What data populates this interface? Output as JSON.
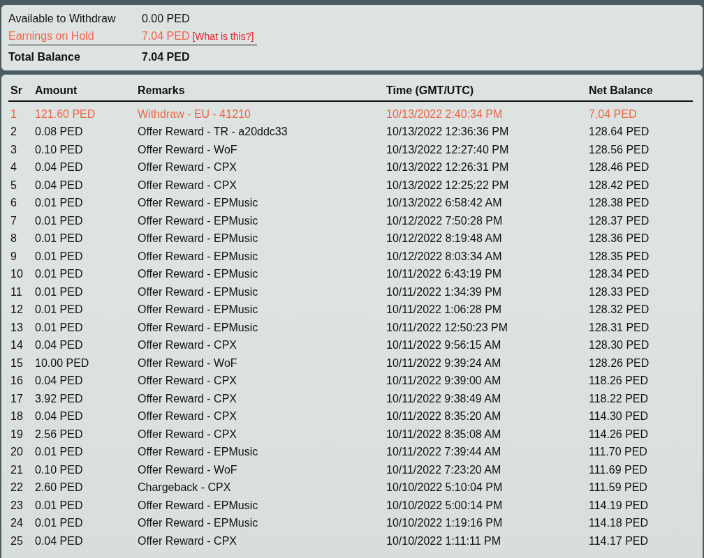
{
  "summary": [
    {
      "kind": "plain",
      "label": "Available to Withdraw",
      "value": "0.00 PED"
    },
    {
      "kind": "hold",
      "label": "Earnings on Hold",
      "value": "7.04 PED",
      "link": "[What is this?]"
    },
    {
      "kind": "total",
      "label": "Total Balance",
      "value": "7.04 PED"
    }
  ],
  "table": {
    "columns": [
      "Sr",
      "Amount",
      "Remarks",
      "Time (GMT/UTC)",
      "Net Balance"
    ],
    "rows": [
      {
        "highlighted": true,
        "cells": [
          "1",
          "121.60 PED",
          "Withdraw - EU - 41210",
          "10/13/2022 2:40:34 PM",
          "7.04 PED"
        ]
      },
      {
        "highlighted": false,
        "cells": [
          "2",
          "0.08 PED",
          "Offer Reward - TR - a20ddc33",
          "10/13/2022 12:36:36 PM",
          "128.64 PED"
        ]
      },
      {
        "highlighted": false,
        "cells": [
          "3",
          "0.10 PED",
          "Offer Reward - WoF",
          "10/13/2022 12:27:40 PM",
          "128.56 PED"
        ]
      },
      {
        "highlighted": false,
        "cells": [
          "4",
          "0.04 PED",
          "Offer Reward - CPX",
          "10/13/2022 12:26:31 PM",
          "128.46 PED"
        ]
      },
      {
        "highlighted": false,
        "cells": [
          "5",
          "0.04 PED",
          "Offer Reward - CPX",
          "10/13/2022 12:25:22 PM",
          "128.42 PED"
        ]
      },
      {
        "highlighted": false,
        "cells": [
          "6",
          "0.01 PED",
          "Offer Reward - EPMusic",
          "10/13/2022 6:58:42 AM",
          "128.38 PED"
        ]
      },
      {
        "highlighted": false,
        "cells": [
          "7",
          "0.01 PED",
          "Offer Reward - EPMusic",
          "10/12/2022 7:50:28 PM",
          "128.37 PED"
        ]
      },
      {
        "highlighted": false,
        "cells": [
          "8",
          "0.01 PED",
          "Offer Reward - EPMusic",
          "10/12/2022 8:19:48 AM",
          "128.36 PED"
        ]
      },
      {
        "highlighted": false,
        "cells": [
          "9",
          "0.01 PED",
          "Offer Reward - EPMusic",
          "10/12/2022 8:03:34 AM",
          "128.35 PED"
        ]
      },
      {
        "highlighted": false,
        "cells": [
          "10",
          "0.01 PED",
          "Offer Reward - EPMusic",
          "10/11/2022 6:43:19 PM",
          "128.34 PED"
        ]
      },
      {
        "highlighted": false,
        "cells": [
          "11",
          "0.01 PED",
          "Offer Reward - EPMusic",
          "10/11/2022 1:34:39 PM",
          "128.33 PED"
        ]
      },
      {
        "highlighted": false,
        "cells": [
          "12",
          "0.01 PED",
          "Offer Reward - EPMusic",
          "10/11/2022 1:06:28 PM",
          "128.32 PED"
        ]
      },
      {
        "highlighted": false,
        "cells": [
          "13",
          "0.01 PED",
          "Offer Reward - EPMusic",
          "10/11/2022 12:50:23 PM",
          "128.31 PED"
        ]
      },
      {
        "highlighted": false,
        "cells": [
          "14",
          "0.04 PED",
          "Offer Reward - CPX",
          "10/11/2022 9:56:15 AM",
          "128.30 PED"
        ]
      },
      {
        "highlighted": false,
        "cells": [
          "15",
          "10.00 PED",
          "Offer Reward - WoF",
          "10/11/2022 9:39:24 AM",
          "128.26 PED"
        ]
      },
      {
        "highlighted": false,
        "cells": [
          "16",
          "0.04 PED",
          "Offer Reward - CPX",
          "10/11/2022 9:39:00 AM",
          "118.26 PED"
        ]
      },
      {
        "highlighted": false,
        "cells": [
          "17",
          "3.92 PED",
          "Offer Reward - CPX",
          "10/11/2022 9:38:49 AM",
          "118.22 PED"
        ]
      },
      {
        "highlighted": false,
        "cells": [
          "18",
          "0.04 PED",
          "Offer Reward - CPX",
          "10/11/2022 8:35:20 AM",
          "114.30 PED"
        ]
      },
      {
        "highlighted": false,
        "cells": [
          "19",
          "2.56 PED",
          "Offer Reward - CPX",
          "10/11/2022 8:35:08 AM",
          "114.26 PED"
        ]
      },
      {
        "highlighted": false,
        "cells": [
          "20",
          "0.01 PED",
          "Offer Reward - EPMusic",
          "10/11/2022 7:39:44 AM",
          "111.70 PED"
        ]
      },
      {
        "highlighted": false,
        "cells": [
          "21",
          "0.10 PED",
          "Offer Reward - WoF",
          "10/11/2022 7:23:20 AM",
          "111.69 PED"
        ]
      },
      {
        "highlighted": false,
        "cells": [
          "22",
          "2.60 PED",
          "Chargeback - CPX",
          "10/10/2022 5:10:04 PM",
          "111.59 PED"
        ]
      },
      {
        "highlighted": false,
        "cells": [
          "23",
          "0.01 PED",
          "Offer Reward - EPMusic",
          "10/10/2022 5:00:14 PM",
          "114.19 PED"
        ]
      },
      {
        "highlighted": false,
        "cells": [
          "24",
          "0.01 PED",
          "Offer Reward - EPMusic",
          "10/10/2022 1:19:16 PM",
          "114.18 PED"
        ]
      },
      {
        "highlighted": false,
        "cells": [
          "25",
          "0.04 PED",
          "Offer Reward - CPX",
          "10/10/2022 1:11:11 PM",
          "114.17 PED"
        ]
      }
    ]
  }
}
